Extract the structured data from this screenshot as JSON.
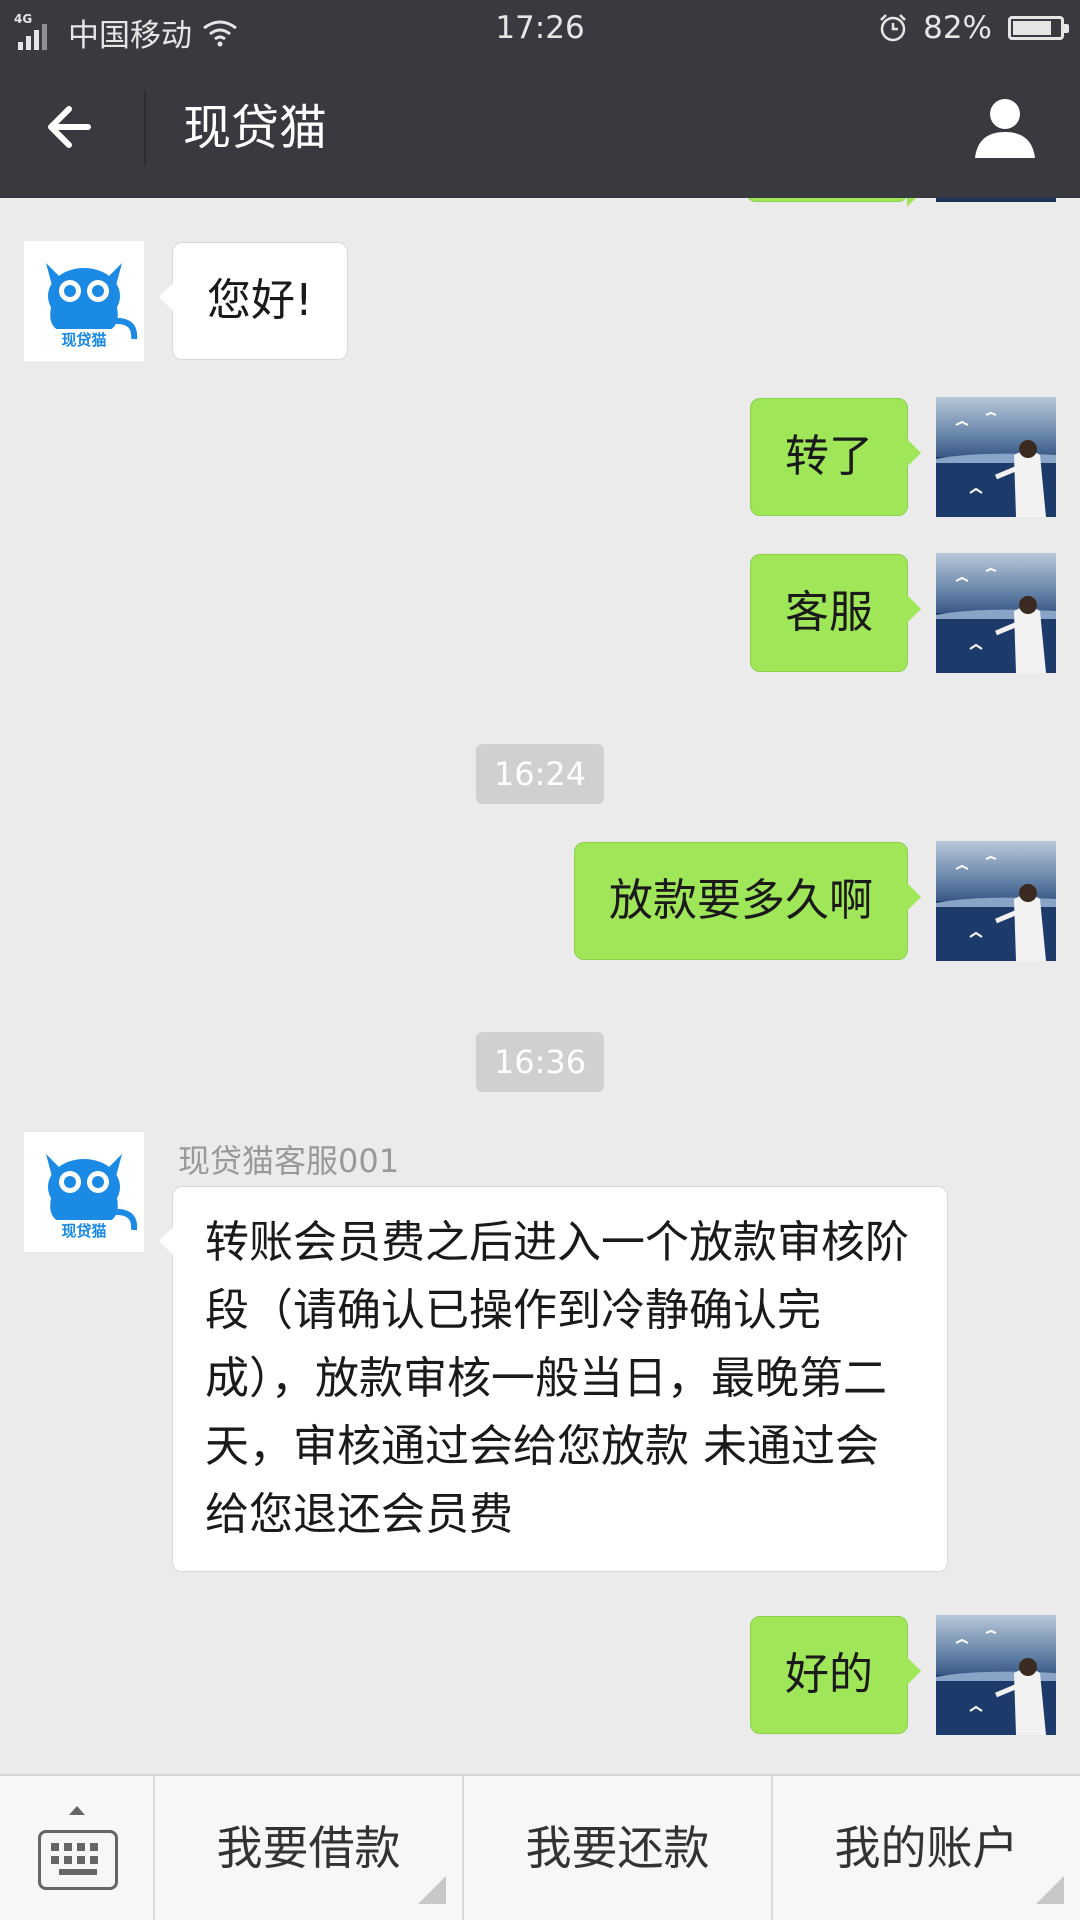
{
  "status_bar": {
    "network_type": "4G",
    "carrier": "中国移动",
    "time": "17:26",
    "battery_percent": "82%",
    "battery_level": 0.82
  },
  "header": {
    "title": "现贷猫",
    "back_icon": "arrow-left-icon",
    "profile_icon": "person-icon"
  },
  "messages": [
    {
      "side": "left",
      "text": "您好!"
    },
    {
      "side": "right",
      "text": "转了"
    },
    {
      "side": "right",
      "text": "客服"
    },
    {
      "type": "time",
      "text": "16:24"
    },
    {
      "side": "right",
      "text": "放款要多久啊"
    },
    {
      "type": "time",
      "text": "16:36"
    },
    {
      "side": "left",
      "sender": "现贷猫客服001",
      "text": "转账会员费之后进入一个放款审核阶段（请确认已操作到冷静确认完成），放款审核一般当日，最晚第二天，审核通过会给您放款 未通过会给您退还会员费"
    },
    {
      "side": "right",
      "text": "好的"
    }
  ],
  "avatar_logo_text": "现贷猫",
  "bottom_menu": {
    "keyboard_icon": "keyboard-icon",
    "items": [
      "我要借款",
      "我要还款",
      "我的账户"
    ]
  },
  "colors": {
    "header_bg": "#393a3f",
    "chat_bg": "#ebebeb",
    "right_bubble": "#9fe658",
    "left_bubble": "#ffffff",
    "brand_blue": "#1a8ae5"
  }
}
